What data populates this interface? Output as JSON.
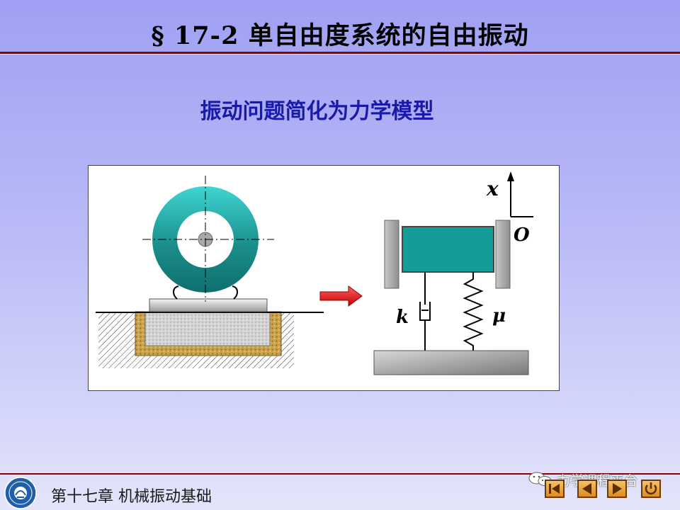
{
  "slide": {
    "title": "§ 17-2  单自由度系统的自由振动",
    "subtitle": "振动问题简化为力学模型",
    "footer": "第十七章  机械振动基础"
  },
  "figure": {
    "label_x": "x",
    "label_o": "O",
    "label_k": "k",
    "label_mu": "μ"
  },
  "watermark": {
    "text": "力学课程平台"
  },
  "nav": {
    "buttons": [
      "first-icon",
      "prev-icon",
      "next-icon",
      "return-icon"
    ]
  },
  "colors": {
    "title_rule": "#8b0000",
    "subtitle": "#1a1aa8",
    "mass": "#139c98",
    "arrow": "#e02020",
    "nav_fill": "#f3c26a"
  }
}
